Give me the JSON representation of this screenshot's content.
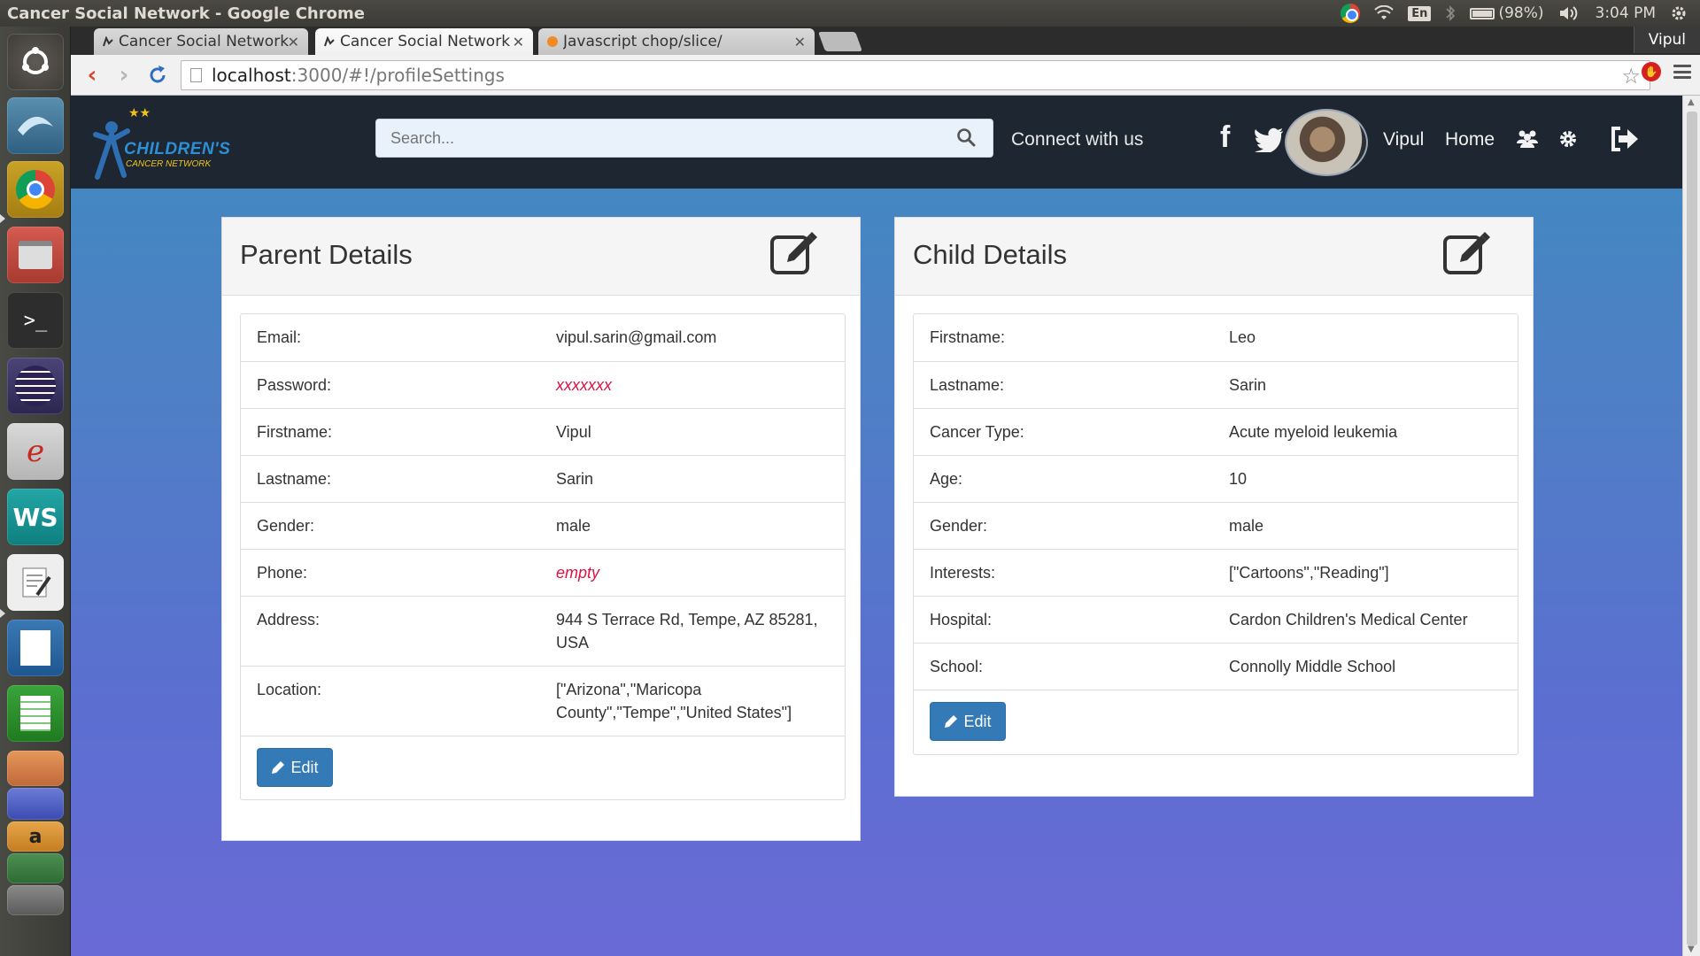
{
  "os": {
    "window_title": "Cancer Social Network - Google Chrome",
    "battery": "(98%)",
    "clock": "3:04 PM",
    "keyboard": "En"
  },
  "browser": {
    "tabs": [
      {
        "label": "Cancer Social Network",
        "active": false
      },
      {
        "label": "Cancer Social Network",
        "active": true
      },
      {
        "label": "Javascript chop/slice/",
        "active": false
      }
    ],
    "user": "Vipul",
    "url_host": "localhost",
    "url_path": ":3000/#!/profileSettings"
  },
  "navbar": {
    "logo_line1": "CHILDREN'S",
    "logo_line2": "CANCER NETWORK",
    "search_placeholder": "Search...",
    "connect_label": "Connect with us",
    "user_name": "Vipul",
    "home_label": "Home"
  },
  "parent": {
    "title": "Parent Details",
    "rows": [
      {
        "label": "Email:",
        "value": "vipul.sarin@gmail.com"
      },
      {
        "label": "Password:",
        "value": "xxxxxxx"
      },
      {
        "label": "Firstname:",
        "value": "Vipul"
      },
      {
        "label": "Lastname:",
        "value": "Sarin"
      },
      {
        "label": "Gender:",
        "value": "male"
      },
      {
        "label": "Phone:",
        "value": "empty"
      },
      {
        "label": "Address:",
        "value": "944 S Terrace Rd, Tempe, AZ 85281, USA"
      },
      {
        "label": "Location:",
        "value": "[\"Arizona\",\"Maricopa County\",\"Tempe\",\"United States\"]"
      }
    ],
    "edit_label": "Edit"
  },
  "child": {
    "title": "Child Details",
    "rows": [
      {
        "label": "Firstname:",
        "value": "Leo"
      },
      {
        "label": "Lastname:",
        "value": "Sarin"
      },
      {
        "label": "Cancer Type:",
        "value": "Acute myeloid leukemia"
      },
      {
        "label": "Age:",
        "value": "10"
      },
      {
        "label": "Gender:",
        "value": "male"
      },
      {
        "label": "Interests:",
        "value": "[\"Cartoons\",\"Reading\"]"
      },
      {
        "label": "Hospital:",
        "value": "Cardon Children's Medical Center"
      },
      {
        "label": "School:",
        "value": "Connolly Middle School"
      }
    ],
    "edit_label": "Edit"
  },
  "colors": {
    "navbar_bg": "#1d2631",
    "primary_button": "#337ab7",
    "empty_value": "#dd1144"
  },
  "icons": [
    "facebook-icon",
    "twitter-icon",
    "youtube-icon",
    "community-icon",
    "gear-icon",
    "logout-icon",
    "edit-icon",
    "pencil-icon",
    "search-icon"
  ]
}
